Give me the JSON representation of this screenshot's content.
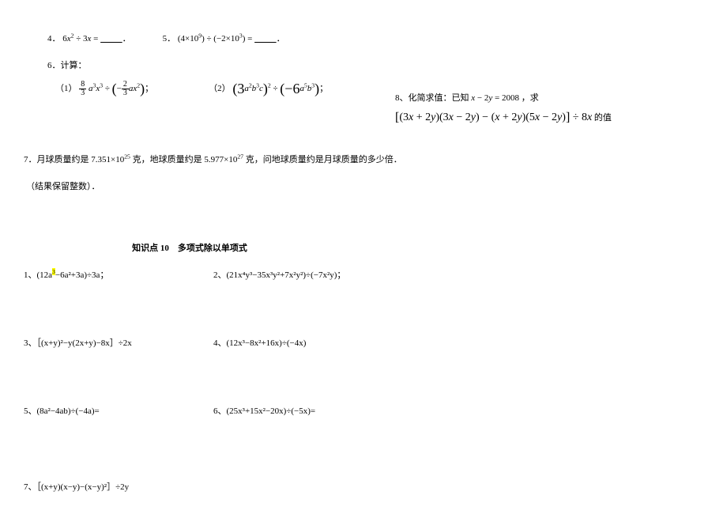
{
  "q4": {
    "label": "4．",
    "expr_prefix": "6",
    "var1": "x",
    "sup1": "2",
    "op": " ÷ 3",
    "var2": "x",
    "eq": " = ",
    "blank": "          ",
    "period": "．"
  },
  "q5": {
    "label": "5．",
    "open1": "(4×10",
    "sup1": "9",
    "mid": ") ÷ (−2×10",
    "sup2": "3",
    "close": ") = ",
    "blank": "          ",
    "period": "．"
  },
  "q6": {
    "label": "6．计算："
  },
  "q6_1": {
    "label": "（1）",
    "frac1_num": "8",
    "frac1_den": "3",
    "a": "a",
    "sup_a": "3",
    "x": "x",
    "sup_x": "3",
    "div": " ÷ ",
    "lparen": "(",
    "neg": "−",
    "frac2_num": "2",
    "frac2_den": "3",
    "ax": "ax",
    "sup_ax": "2",
    "rparen": ")",
    "semi": "；"
  },
  "q6_2": {
    "label": "（2）",
    "l1": "(3",
    "a1": "a",
    "s1": "2",
    "b1": "b",
    "s2": "3",
    "c": "c",
    "r1": ")",
    "s3": "2",
    "div": " ÷ ",
    "l2": "(−6",
    "a2": "a",
    "s4": "5",
    "b2": "b",
    "s5": "3",
    "r2": ")",
    "semi": "；"
  },
  "q7": {
    "text": "7．月球质量约是 7.351×10",
    "sup1": "25",
    "mid": " 克，地球质量约是 5.977×10",
    "sup2": "27",
    "tail": " 克，问地球质量约是月球质量的多少倍．"
  },
  "q7_note": {
    "text": "（结果保留整数）．"
  },
  "q8": {
    "label": "8、化简求值：已知 ",
    "x": "x",
    "minus": " − 2",
    "y": "y",
    "eq": " = 2008 ，求"
  },
  "q8_expr": {
    "lb": "[",
    "p1": "(3",
    "x1": "x",
    "p2": " + 2",
    "y1": "y",
    "p3": ")(3",
    "x2": "x",
    "p4": " − 2",
    "y2": "y",
    "p5": ") − (",
    "x3": "x",
    "p6": " + 2",
    "y3": "y",
    "p7": ")(5",
    "x4": "x",
    "p8": " − 2",
    "y4": "y",
    "p9": ")",
    "rb": "]",
    "div": " ÷ 8",
    "x5": "x",
    "tail": " 的值"
  },
  "section_title": "知识点 10　多项式除以单项式",
  "kp1": {
    "label": "1、(12a",
    "hl": "3",
    "rest": "−6a²+3a)÷3a；"
  },
  "kp2": {
    "text": "2、(21x⁴y³−35x³y²+7x²y²)÷(−7x²y)；"
  },
  "kp3": {
    "text": "3、［(x+y)²−y(2x+y)−8x］÷2x"
  },
  "kp4": {
    "text": "4、(12x³−8x²+16x)÷(−4x)"
  },
  "kp5": {
    "text": "5、(8a²−4ab)÷(−4a)="
  },
  "kp6": {
    "text": "6、(25x³+15x²−20x)÷(−5x)="
  },
  "kp7": {
    "text": "7、［(x+y)(x−y)−(x−y)²］÷2y"
  }
}
